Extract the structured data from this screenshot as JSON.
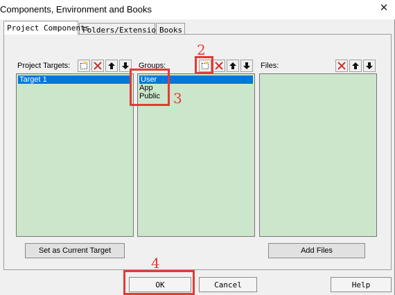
{
  "window": {
    "title": "Components, Environment and Books"
  },
  "tabs": [
    {
      "label": "Project Components"
    },
    {
      "label": "Folders/Extensions"
    },
    {
      "label": "Books"
    }
  ],
  "panels": {
    "targets": {
      "label": "Project Targets:",
      "items": [
        "Target 1"
      ]
    },
    "groups": {
      "label": "Groups:",
      "items": [
        "User",
        "App",
        "Public"
      ]
    },
    "files": {
      "label": "Files:",
      "items": []
    }
  },
  "buttons": {
    "set_target": "Set as Current Target",
    "add_files": "Add Files",
    "ok": "OK",
    "cancel": "Cancel",
    "help": "Help"
  },
  "annotations": {
    "n2": "2",
    "n3": "3",
    "n4": "4",
    "color": "#e53935"
  },
  "colors": {
    "list_bg": "#cce6cc",
    "selection": "#0078d7"
  },
  "icons": [
    "new-icon",
    "delete-icon",
    "move-up-icon",
    "move-down-icon",
    "close-icon"
  ]
}
